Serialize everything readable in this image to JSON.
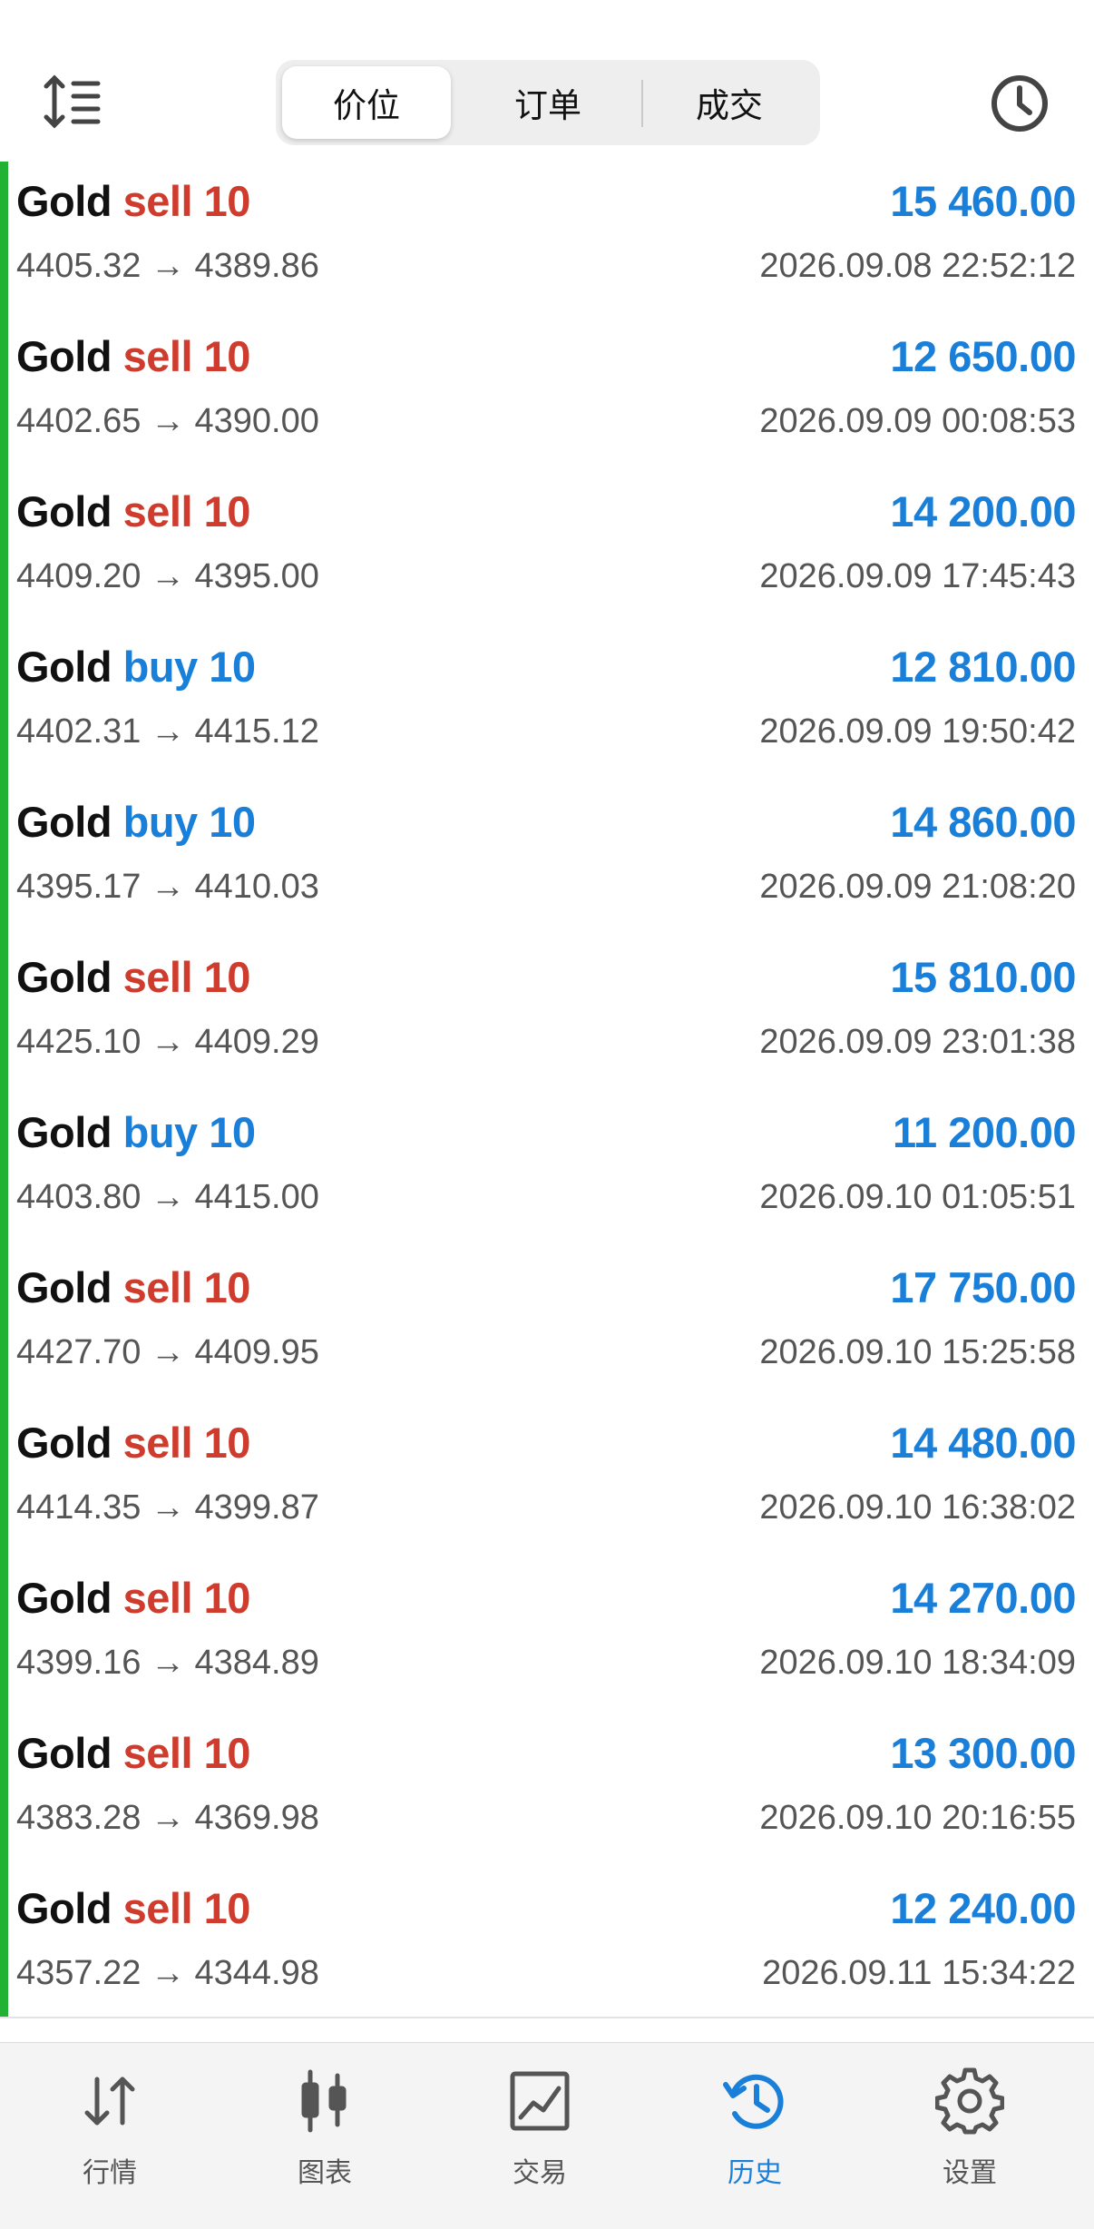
{
  "header": {
    "segments": [
      "价位",
      "订单",
      "成交"
    ],
    "active_segment": 0
  },
  "colors": {
    "accent": "#1a7fd8",
    "sell": "#cf3b2c",
    "buy": "#1a7fd8",
    "indicator": "#21b233"
  },
  "trades": [
    {
      "symbol": "Gold",
      "side": "sell",
      "volume": "10",
      "profit": "15 460.00",
      "open_price": "4405.32",
      "close_price": "4389.86",
      "time": "2026.09.08 22:52:12"
    },
    {
      "symbol": "Gold",
      "side": "sell",
      "volume": "10",
      "profit": "12 650.00",
      "open_price": "4402.65",
      "close_price": "4390.00",
      "time": "2026.09.09 00:08:53"
    },
    {
      "symbol": "Gold",
      "side": "sell",
      "volume": "10",
      "profit": "14 200.00",
      "open_price": "4409.20",
      "close_price": "4395.00",
      "time": "2026.09.09 17:45:43"
    },
    {
      "symbol": "Gold",
      "side": "buy",
      "volume": "10",
      "profit": "12 810.00",
      "open_price": "4402.31",
      "close_price": "4415.12",
      "time": "2026.09.09 19:50:42"
    },
    {
      "symbol": "Gold",
      "side": "buy",
      "volume": "10",
      "profit": "14 860.00",
      "open_price": "4395.17",
      "close_price": "4410.03",
      "time": "2026.09.09 21:08:20"
    },
    {
      "symbol": "Gold",
      "side": "sell",
      "volume": "10",
      "profit": "15 810.00",
      "open_price": "4425.10",
      "close_price": "4409.29",
      "time": "2026.09.09 23:01:38"
    },
    {
      "symbol": "Gold",
      "side": "buy",
      "volume": "10",
      "profit": "11 200.00",
      "open_price": "4403.80",
      "close_price": "4415.00",
      "time": "2026.09.10 01:05:51"
    },
    {
      "symbol": "Gold",
      "side": "sell",
      "volume": "10",
      "profit": "17 750.00",
      "open_price": "4427.70",
      "close_price": "4409.95",
      "time": "2026.09.10 15:25:58"
    },
    {
      "symbol": "Gold",
      "side": "sell",
      "volume": "10",
      "profit": "14 480.00",
      "open_price": "4414.35",
      "close_price": "4399.87",
      "time": "2026.09.10 16:38:02"
    },
    {
      "symbol": "Gold",
      "side": "sell",
      "volume": "10",
      "profit": "14 270.00",
      "open_price": "4399.16",
      "close_price": "4384.89",
      "time": "2026.09.10 18:34:09"
    },
    {
      "symbol": "Gold",
      "side": "sell",
      "volume": "10",
      "profit": "13 300.00",
      "open_price": "4383.28",
      "close_price": "4369.98",
      "time": "2026.09.10 20:16:55"
    },
    {
      "symbol": "Gold",
      "side": "sell",
      "volume": "10",
      "profit": "12 240.00",
      "open_price": "4357.22",
      "close_price": "4344.98",
      "time": "2026.09.11 15:34:22"
    }
  ],
  "arrow": "→",
  "tabs": [
    {
      "label": "行情",
      "icon": "quotes-arrows-icon"
    },
    {
      "label": "图表",
      "icon": "candlestick-chart-icon"
    },
    {
      "label": "交易",
      "icon": "trade-chart-icon"
    },
    {
      "label": "历史",
      "icon": "history-clock-icon"
    },
    {
      "label": "设置",
      "icon": "gear-icon"
    }
  ],
  "active_tab": 3
}
